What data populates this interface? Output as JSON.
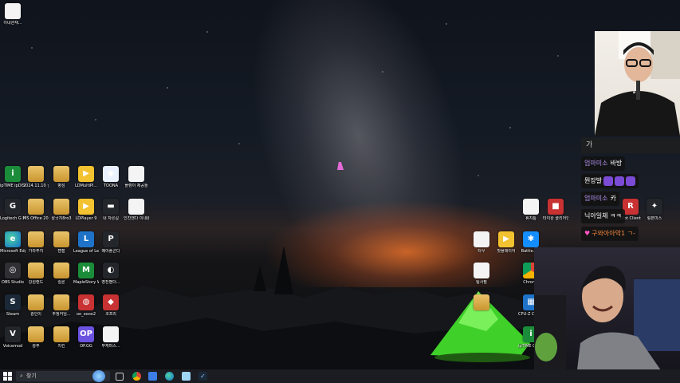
{
  "desktop": {
    "icons": [
      {
        "label": "이내관재...",
        "type": "file"
      },
      {
        "label": "ipTIME ipDISK Drive",
        "type": "green",
        "glyph": "i"
      },
      {
        "label": "2024.11.10 결과론 정...",
        "type": "folder"
      },
      {
        "label": "병성",
        "type": "folder"
      },
      {
        "label": "LDMultiPl...",
        "type": "yellow",
        "glyph": "▶"
      },
      {
        "label": "TOONA",
        "type": "toona",
        "glyph": "◉"
      },
      {
        "label": "플렝이 제공툴",
        "type": "file"
      },
      {
        "label": "Logitech G HUB",
        "type": "dark",
        "glyph": "G"
      },
      {
        "label": "MS Office 2016 64bit",
        "type": "folder"
      },
      {
        "label": "삼국지8ro3",
        "type": "folder"
      },
      {
        "label": "LDPlayer 9",
        "type": "yellow",
        "glyph": "▶"
      },
      {
        "label": "내 자른길",
        "type": "dark",
        "glyph": "▬"
      },
      {
        "label": "인진앤다 이내활운...",
        "type": "file"
      },
      {
        "label": "Microsoft Edge",
        "type": "edge",
        "glyph": "e"
      },
      {
        "label": "가라주지",
        "type": "folder"
      },
      {
        "label": "캠철",
        "type": "folder"
      },
      {
        "label": "League of Legends",
        "type": "blue",
        "glyph": "L"
      },
      {
        "label": "메이플콘디",
        "type": "dark",
        "glyph": "P"
      },
      {
        "label": "OBS Studio",
        "type": "obs",
        "glyph": "◎"
      },
      {
        "label": "강원랜드",
        "type": "folder"
      },
      {
        "label": "릴론",
        "type": "folder"
      },
      {
        "label": "MapleStory Worlds",
        "type": "green",
        "glyph": "M"
      },
      {
        "label": "영전팬더...",
        "type": "dark",
        "glyph": "◐"
      },
      {
        "label": "Steam",
        "type": "steam",
        "glyph": "S"
      },
      {
        "label": "광인이",
        "type": "folder"
      },
      {
        "label": "추정커임...",
        "type": "folder"
      },
      {
        "label": "oo_oooo2",
        "type": "red",
        "glyph": "◍"
      },
      {
        "label": "코프리",
        "type": "red",
        "glyph": "◆"
      },
      {
        "label": "Voicemod",
        "type": "dark",
        "glyph": "V"
      },
      {
        "label": "광주",
        "type": "folder"
      },
      {
        "label": "치킨",
        "type": "folder"
      },
      {
        "label": "OP.GG",
        "type": "purple",
        "glyph": "OP"
      },
      {
        "label": "부캐마스...",
        "type": "file"
      },
      {
        "label": "휴지통",
        "type": "file"
      },
      {
        "label": "타이완 클리어엔트",
        "type": "red",
        "glyph": "■"
      },
      {
        "label": "Riot Client",
        "type": "red",
        "glyph": "R"
      },
      {
        "label": "링본미스",
        "type": "dark",
        "glyph": "✦"
      },
      {
        "label": "타우",
        "type": "file"
      },
      {
        "label": "팟플레이어",
        "type": "yellow",
        "glyph": "▶"
      },
      {
        "label": "Battle.net",
        "type": "battle",
        "glyph": "✱"
      },
      {
        "label": "팀사필",
        "type": "file"
      },
      {
        "label": "Chrome",
        "type": "chrome",
        "glyph": ""
      },
      {
        "label": "CPU-Z CPU-Z",
        "type": "blue",
        "glyph": "▦"
      },
      {
        "label": "ipTIME Cloud",
        "type": "green",
        "glyph": "i"
      },
      {
        "label": "",
        "type": "folder"
      }
    ]
  },
  "chat": {
    "header_text": "가",
    "messages": [
      {
        "nick": "엄마미소",
        "text": "바방",
        "emotes": 0
      },
      {
        "nick": "",
        "text": "뭔장발",
        "emotes": 3
      },
      {
        "nick": "엄마미소",
        "text": "카",
        "emotes": 0
      },
      {
        "nick": "",
        "text": "닉아일체 ㅋㅋ",
        "emotes": 0
      },
      {
        "nick": "",
        "text": "구와아아악1 ㄱ-",
        "emotes": 0,
        "heart": true
      }
    ]
  },
  "taskbar": {
    "start_icon": "windows-logo",
    "search_placeholder": "찾기",
    "pinned": [
      "task-view",
      "chrome",
      "app-blue",
      "edge",
      "notepad",
      "steam"
    ]
  }
}
